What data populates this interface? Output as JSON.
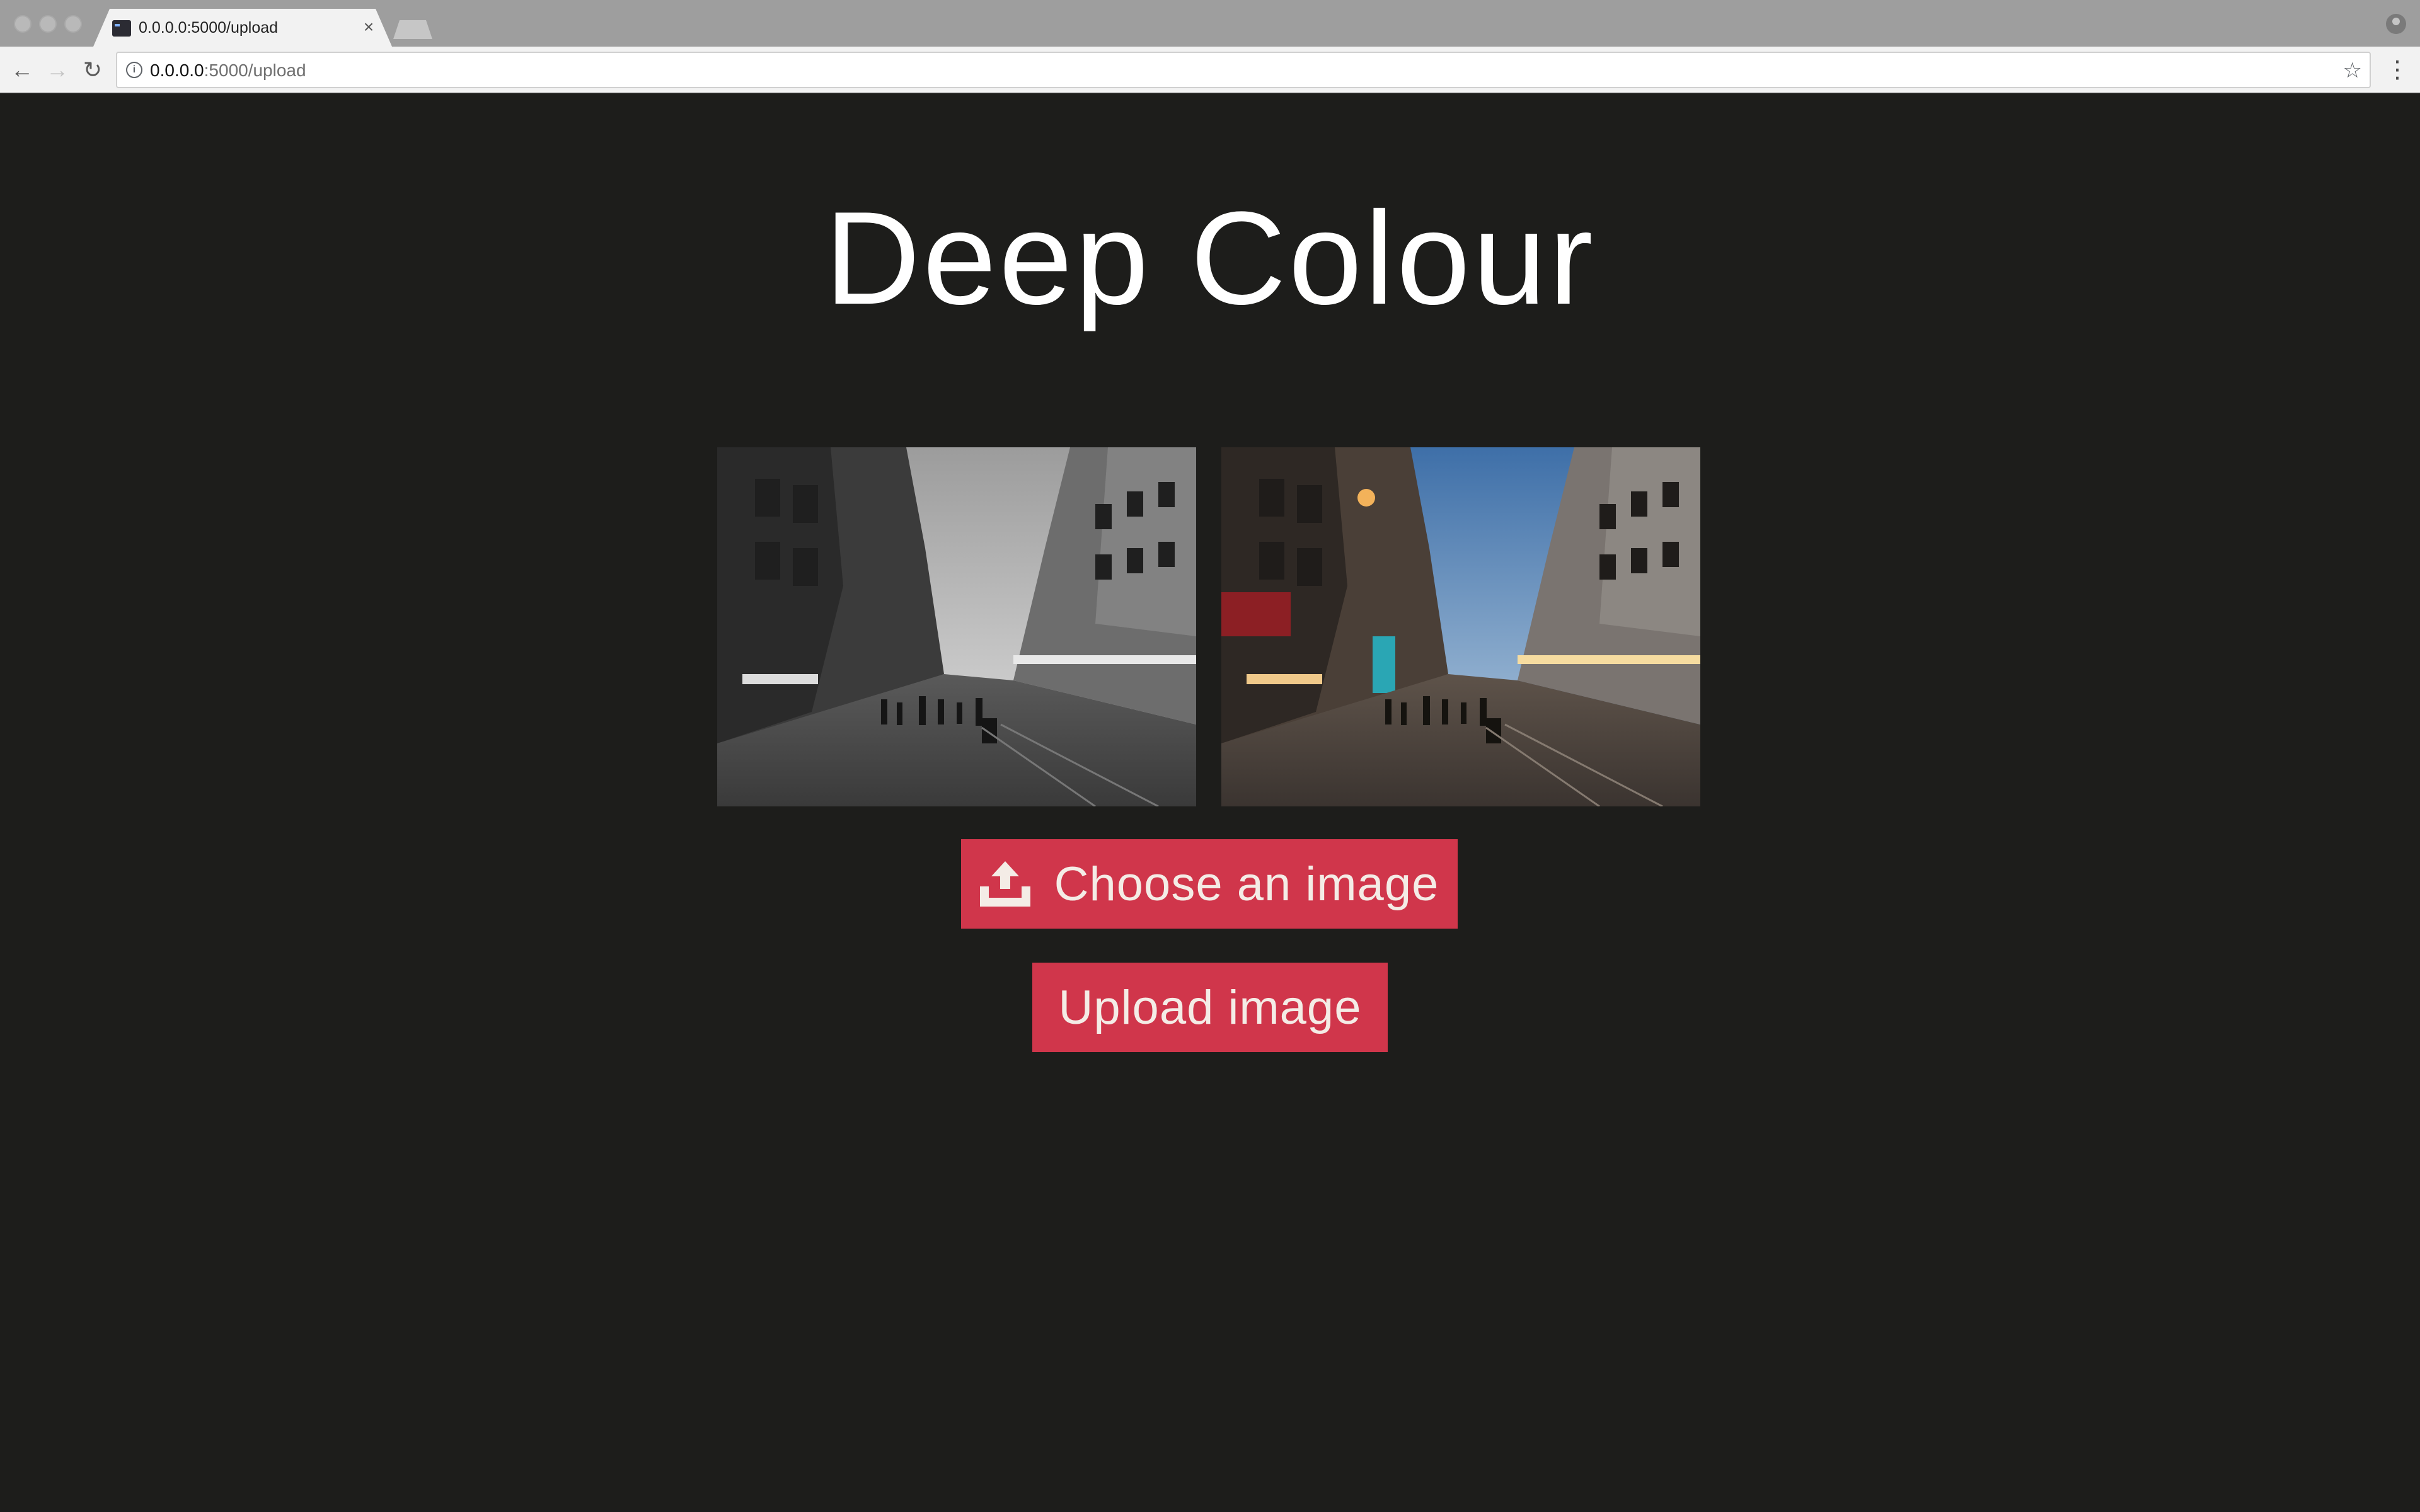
{
  "browser": {
    "tab_title": "0.0.0.0:5000/upload",
    "tab_close": "×",
    "url_host": "0.0.0.0",
    "url_path": ":5000/upload",
    "back_glyph": "←",
    "forward_glyph": "→",
    "reload_glyph": "↻",
    "info_glyph": "i",
    "star_glyph": "☆",
    "menu_glyph": "⋮"
  },
  "page": {
    "title": "Deep Colour",
    "choose_button_label": "Choose an image",
    "upload_button_label": "Upload image",
    "images": [
      {
        "name": "grayscale-street-photo",
        "style": "grayscale"
      },
      {
        "name": "colourized-street-photo",
        "style": "colour"
      }
    ]
  },
  "colors": {
    "background": "#1d1d1b",
    "accent": "#d0364b",
    "title_text": "#ffffff"
  }
}
